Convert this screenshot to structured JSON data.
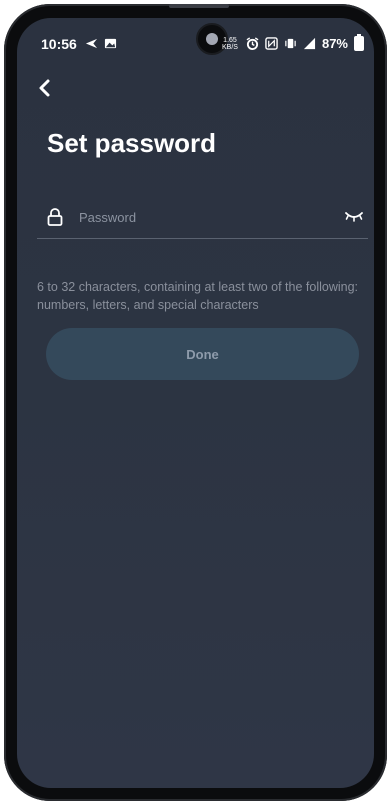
{
  "status_bar": {
    "time": "10:56",
    "net_speed_value": "1.65",
    "net_speed_unit": "KB/S",
    "battery": "87%"
  },
  "header": {
    "back_icon": "back-arrow-icon",
    "title": "Set password"
  },
  "password_field": {
    "placeholder": "Password",
    "value": "",
    "lock_icon": "lock-icon",
    "visibility_icon": "eye-closed-icon"
  },
  "hint": "6 to 32 characters, containing at least two of the following: numbers, letters, and special characters",
  "done_button": {
    "label": "Done"
  },
  "colors": {
    "background": "#2c3442",
    "button_bg": "#34495b",
    "button_text": "#8e9bab",
    "hint_text": "#8a909c"
  }
}
